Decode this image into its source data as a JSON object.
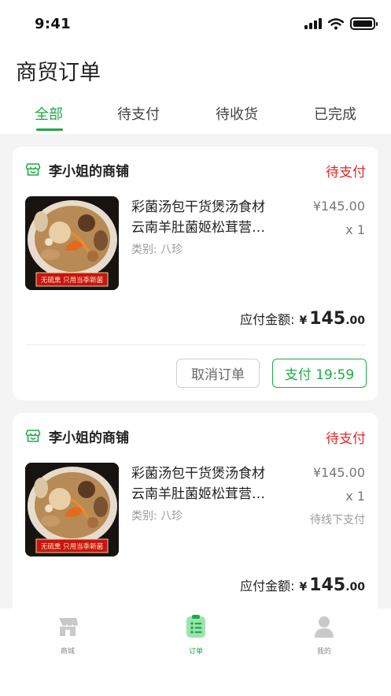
{
  "status_bar": {
    "time": "9:41"
  },
  "page": {
    "title": "商贸订单"
  },
  "tabs": [
    {
      "label": "全部",
      "active": true
    },
    {
      "label": "待支付",
      "active": false
    },
    {
      "label": "待收货",
      "active": false
    },
    {
      "label": "已完成",
      "active": false
    }
  ],
  "orders": [
    {
      "shop_name": "李小姐的商铺",
      "status": "待支付",
      "product": {
        "name_line1": "彩菌汤包干货煲汤食材",
        "name_line2": "云南羊肚菌姬松茸营…",
        "category": "类别: 八珍",
        "price": "¥145.00",
        "quantity": "x 1",
        "image_banner": "无硫熏 只用当季新菌"
      },
      "total": {
        "label": "应付金额:",
        "currency": "¥",
        "integer": "145",
        "decimal": ".00"
      },
      "buttons": {
        "cancel": "取消订单",
        "pay": "支付 19:59"
      }
    },
    {
      "shop_name": "李小姐的商铺",
      "status": "待支付",
      "product": {
        "name_line1": "彩菌汤包干货煲汤食材",
        "name_line2": "云南羊肚菌姬松茸营…",
        "category": "类别: 八珍",
        "price": "¥145.00",
        "quantity": "x 1",
        "note": "待线下支付",
        "image_banner": "无硫熏 只用当季新菌"
      },
      "total": {
        "label": "应付金额:",
        "currency": "¥",
        "integer": "145",
        "decimal": ".00"
      }
    }
  ],
  "bottom_nav": [
    {
      "label": "商城",
      "icon": "store-icon",
      "active": false
    },
    {
      "label": "订单",
      "icon": "order-list-icon",
      "active": true
    },
    {
      "label": "我的",
      "icon": "profile-icon",
      "active": false
    }
  ],
  "colors": {
    "accent": "#1eaa46",
    "status_red": "#e02828",
    "background": "#f4f4f4"
  }
}
